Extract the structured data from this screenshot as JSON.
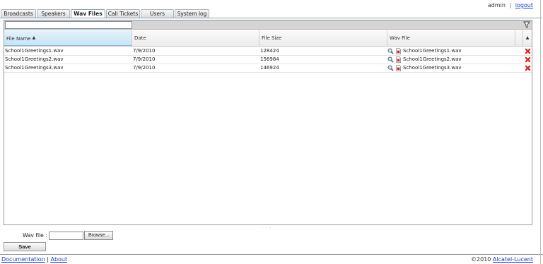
{
  "header": {
    "user": "admin",
    "separator": "|",
    "logout": "logout"
  },
  "tabs": [
    "Broadcasts",
    "Speakers",
    "Wav Files",
    "Call Tickets",
    "Users",
    "System log"
  ],
  "active_tab": "Wav Files",
  "filter": {
    "value": ""
  },
  "table": {
    "columns": [
      "File Name",
      "Date",
      "File Size",
      "Wav File"
    ],
    "sorted_column": "File Name",
    "sort_indicator": "▲",
    "rows": [
      {
        "file_name": "School1Greetings1.wav",
        "date": "7/9/2010",
        "size": "128424",
        "wav": "School1Greetings1.wav"
      },
      {
        "file_name": "School1Greetings2.wav",
        "date": "7/9/2010",
        "size": "156984",
        "wav": "School1Greetings2.wav"
      },
      {
        "file_name": "School1Greetings3.wav",
        "date": "7/9/2010",
        "size": "146924",
        "wav": "School1Greetings3.wav"
      }
    ]
  },
  "splitter": "· · ·",
  "form": {
    "wav_label": "Wav file :",
    "wav_value": "",
    "browse": "Browse...",
    "save": "Save"
  },
  "footer": {
    "documentation": "Documentation",
    "separator": "|",
    "about": "About",
    "copyright": "©2010",
    "company": "Alcatel-Lucent"
  },
  "icons": [
    "search-icon",
    "wav-file-icon",
    "delete-icon",
    "filter-icon"
  ],
  "colors": {
    "link": "#1a3ec0",
    "sorted_header": "#c9e4f6",
    "delete": "#d6291c"
  }
}
